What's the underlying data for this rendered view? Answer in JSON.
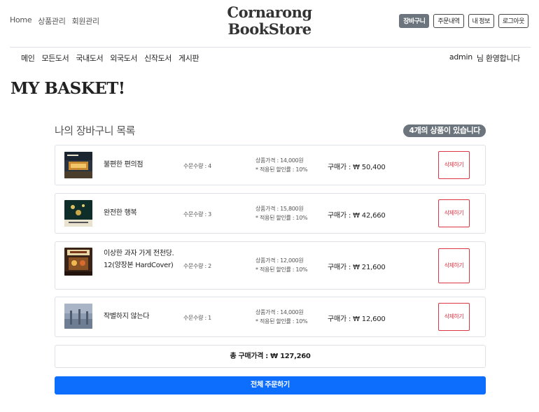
{
  "header": {
    "left_links": [
      "Home",
      "상품관리",
      "회원관리"
    ],
    "logo_line1": "Cornarong",
    "logo_line2": "BookStore",
    "right_buttons": [
      "장바구니",
      "주문내역",
      "내 정보",
      "로그아웃"
    ]
  },
  "nav": {
    "items": [
      "메인",
      "모든도서",
      "국내도서",
      "외국도서",
      "신작도서",
      "게시판"
    ],
    "user": "admin",
    "welcome": "님 환영합니다"
  },
  "page": {
    "title": "MY BASKET!"
  },
  "basket": {
    "title": "나의 장바구니 목록",
    "count_badge": "4개의 상품이 있습니다",
    "items": [
      {
        "name": "불편한 편의점",
        "qty": "수문수량 : 4",
        "price": "상품가격 : 14,000원",
        "discount": "* 적용된 할인률 : 10%",
        "buy": "구매가 : ₩ 50,400",
        "delete": "삭제하기"
      },
      {
        "name": "완전한 행복",
        "qty": "수문수량 : 3",
        "price": "상품가격 : 15,800원",
        "discount": "* 적용된 할인률 : 10%",
        "buy": "구매가 : ₩ 42,660",
        "delete": "삭제하기"
      },
      {
        "name": "이상한 과자 가게 전천당. 12(양장본 HardCover)",
        "qty": "수문수량 : 2",
        "price": "상품가격 : 12,000원",
        "discount": "* 적용된 할인률 : 10%",
        "buy": "구매가 : ₩ 21,600",
        "delete": "삭제하기"
      },
      {
        "name": "작별하지 않는다",
        "qty": "수문수량 : 1",
        "price": "상품가격 : 14,000원",
        "discount": "* 적용된 할인률 : 10%",
        "buy": "구매가 : ₩ 12,600",
        "delete": "삭제하기"
      }
    ],
    "total": "총 구매가격 : ₩ 127,260",
    "order_button": "전체 주문하기"
  },
  "colors": {
    "primary": "#0d6efd",
    "secondary": "#6c757d",
    "danger": "#dc3545"
  }
}
